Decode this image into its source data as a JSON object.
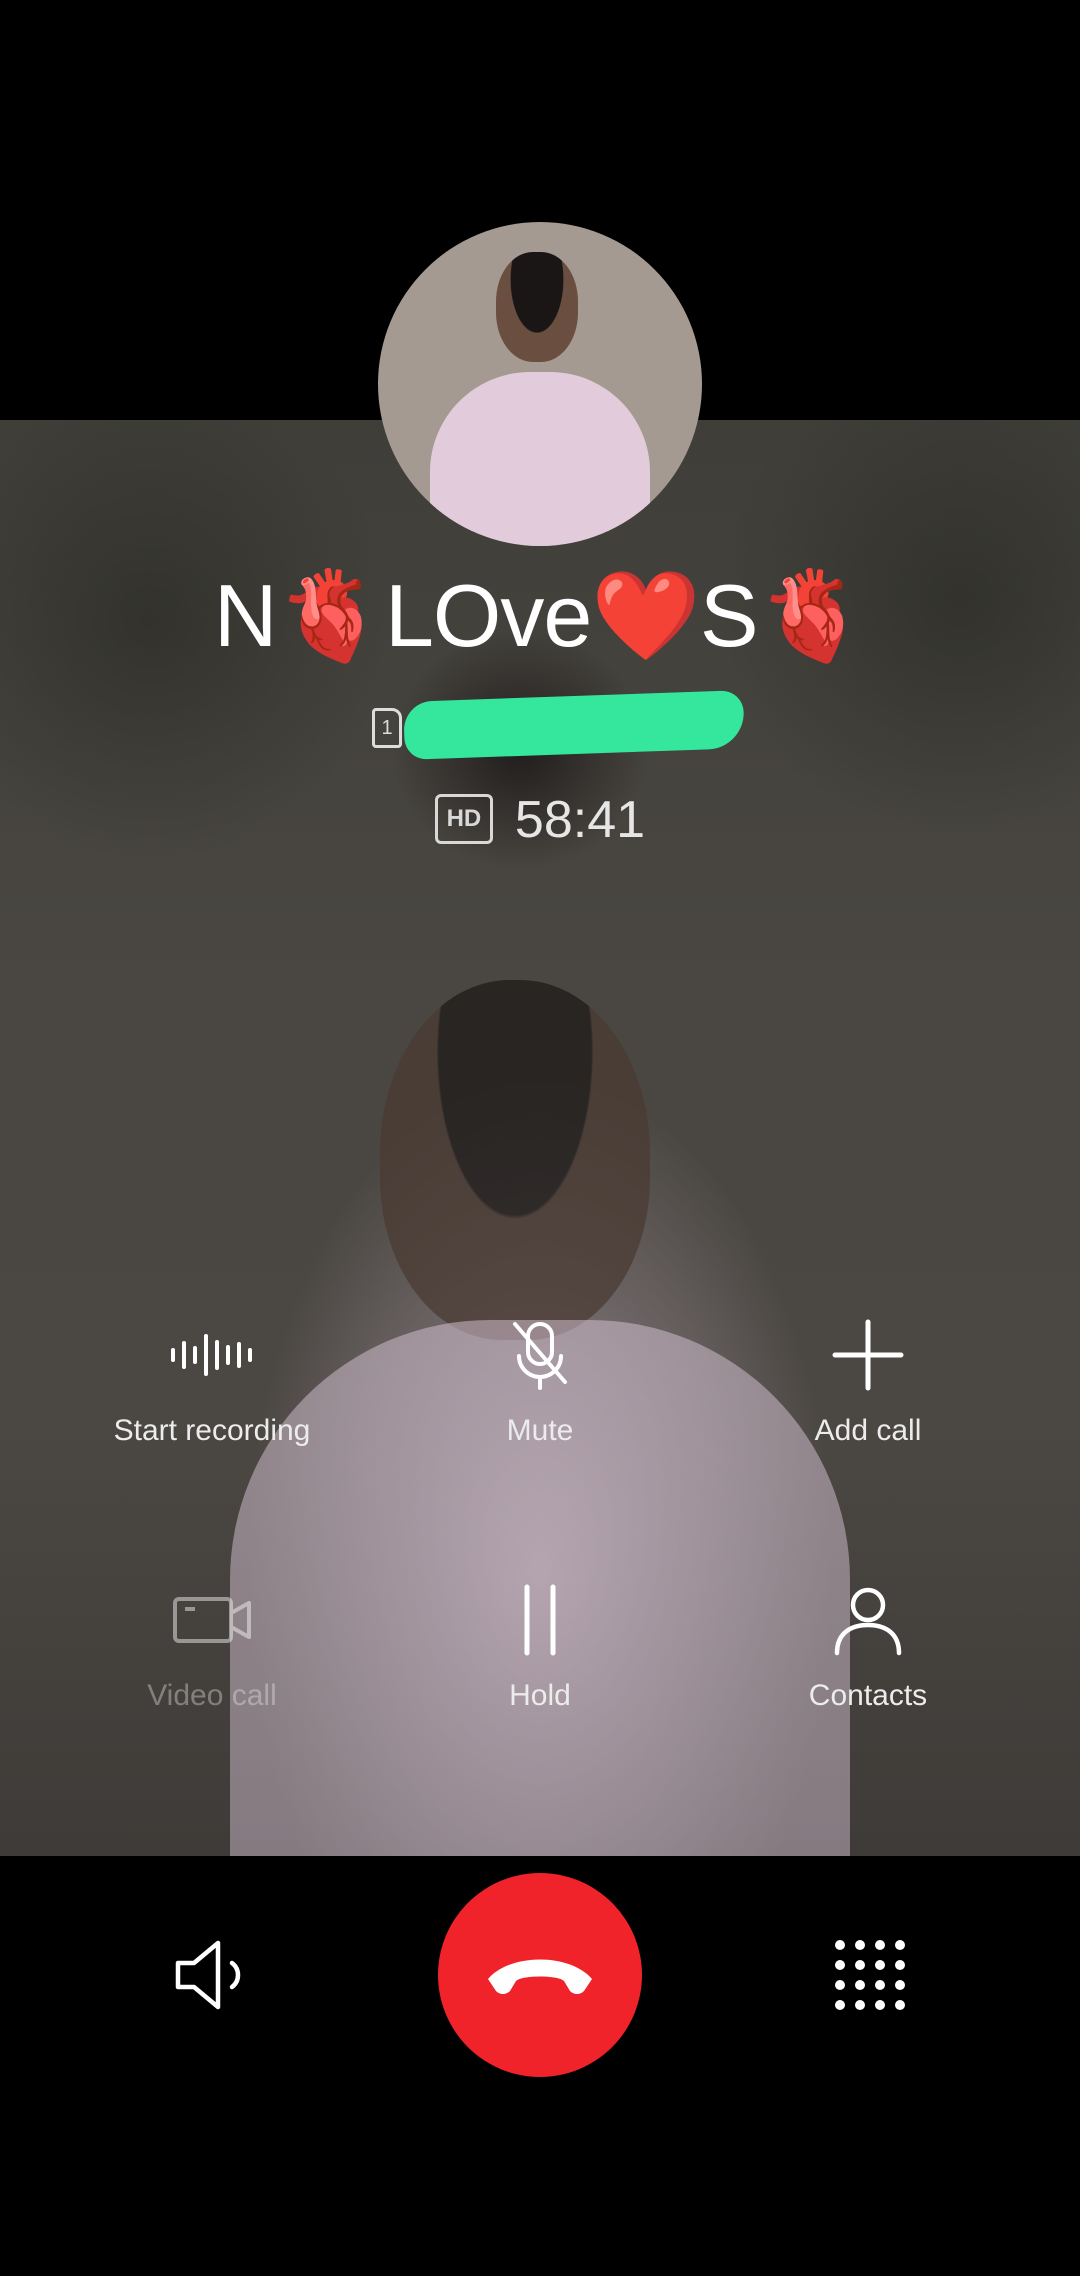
{
  "caller": {
    "name": "N🫀LOve❤️S🫀"
  },
  "call": {
    "hd_badge": "HD",
    "duration": "58:41",
    "sim_slot": "1"
  },
  "actions": {
    "start_recording": "Start recording",
    "mute": "Mute",
    "add_call": "Add call",
    "video_call": "Video call",
    "hold": "Hold",
    "contacts": "Contacts"
  },
  "colors": {
    "end_call": "#f0232b",
    "redaction": "#35e79d",
    "background": "#000000"
  },
  "icons": {
    "recording": "waveform-icon",
    "mute": "mic-off-icon",
    "add_call": "plus-icon",
    "video_call": "video-camera-icon",
    "hold": "pause-icon",
    "contacts": "person-icon",
    "speaker": "speaker-icon",
    "end_call": "phone-hangup-icon",
    "dialpad": "dialpad-icon"
  }
}
